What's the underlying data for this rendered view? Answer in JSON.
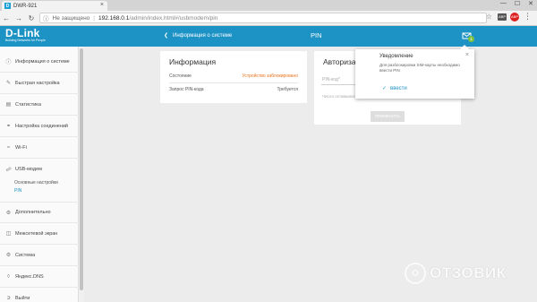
{
  "browser": {
    "tab_title": "DWR-921",
    "favicon_letter": "D",
    "tab_close": "×",
    "win_min": "—",
    "win_max": "☐",
    "win_close": "✕",
    "security": "Не защищено",
    "url_host": "192.168.0.1",
    "url_path": "/admin/index.html#/usbmodem/pin",
    "ext1_label": "ABP",
    "ext2_label": "ABP"
  },
  "header": {
    "logo_name": "D-Link",
    "logo_sub": "Building Networks for People",
    "back_label": "Информация о системе",
    "page_title": "PIN",
    "notification_count": "1"
  },
  "sidebar": {
    "items": [
      {
        "label": "Информация о системе",
        "icon": "info-icon"
      },
      {
        "label": "Быстрая настройка",
        "icon": "wizard-icon"
      },
      {
        "label": "Статистика",
        "icon": "stats-icon"
      },
      {
        "label": "Настройка соединений",
        "icon": "connections-icon"
      },
      {
        "label": "Wi-Fi",
        "icon": "wifi-icon"
      },
      {
        "label": "USB-модем",
        "icon": "usb-icon"
      },
      {
        "label": "Дополнительно",
        "icon": "advanced-icon"
      },
      {
        "label": "Межсетевой экран",
        "icon": "firewall-icon"
      },
      {
        "label": "Система",
        "icon": "system-icon"
      },
      {
        "label": "Яндекс.DNS",
        "icon": "dns-icon"
      },
      {
        "label": "Выйти",
        "icon": "logout-icon"
      }
    ],
    "subitems": [
      "Основные настройки",
      "PIN"
    ]
  },
  "info_card": {
    "title": "Информация",
    "rows": [
      {
        "label": "Состояние",
        "value": "Устройство заблокировано"
      },
      {
        "label": "Запрос PIN-кода",
        "value": "Требуется"
      }
    ]
  },
  "auth_card": {
    "title": "Авторизация",
    "pin_placeholder": "PIN-код*",
    "attempts_text": "Число оставшихся попыток",
    "apply_label": "ПРИМЕНИТЬ"
  },
  "popup": {
    "title": "Уведомление",
    "text": "Для разблокировки SIM-карты необходимо ввести PIN",
    "close": "×",
    "action": "ввести"
  },
  "watermark": {
    "text": "ОТЗОВИК"
  }
}
